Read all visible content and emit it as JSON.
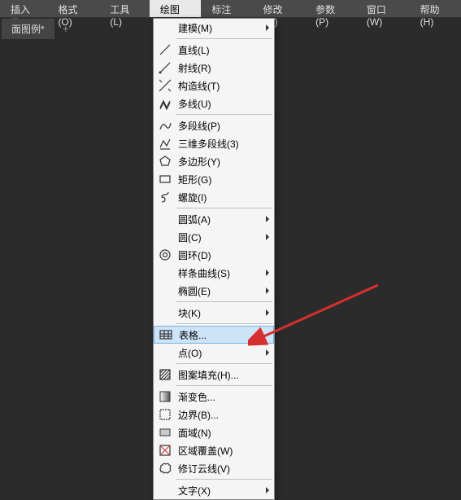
{
  "menubar": [
    {
      "label": "插入(I)"
    },
    {
      "label": "格式(O)"
    },
    {
      "label": "工具(L)"
    },
    {
      "label": "绘图(D)",
      "active": true
    },
    {
      "label": "标注(N)"
    },
    {
      "label": "修改(M)"
    },
    {
      "label": "参数(P)"
    },
    {
      "label": "窗口(W)"
    },
    {
      "label": "帮助(H)"
    }
  ],
  "tab": {
    "label": "面图例*"
  },
  "menu_groups": [
    [
      {
        "label": "建模(M)",
        "icon": "",
        "submenu": true
      }
    ],
    [
      {
        "label": "直线(L)",
        "icon": "line"
      },
      {
        "label": "射线(R)",
        "icon": "ray"
      },
      {
        "label": "构造线(T)",
        "icon": "xline"
      },
      {
        "label": "多线(U)",
        "icon": "mline"
      }
    ],
    [
      {
        "label": "多段线(P)",
        "icon": "pline"
      },
      {
        "label": "三维多段线(3)",
        "icon": "pline3d"
      },
      {
        "label": "多边形(Y)",
        "icon": "polygon"
      },
      {
        "label": "矩形(G)",
        "icon": "rect"
      },
      {
        "label": "螺旋(I)",
        "icon": "helix"
      }
    ],
    [
      {
        "label": "圆弧(A)",
        "icon": "",
        "submenu": true
      },
      {
        "label": "圆(C)",
        "icon": "",
        "submenu": true
      },
      {
        "label": "圆环(D)",
        "icon": "donut"
      },
      {
        "label": "样条曲线(S)",
        "icon": "",
        "submenu": true
      },
      {
        "label": "椭圆(E)",
        "icon": "",
        "submenu": true
      }
    ],
    [
      {
        "label": "块(K)",
        "icon": "",
        "submenu": true
      }
    ],
    [
      {
        "label": "表格...",
        "icon": "table",
        "highlight": true
      },
      {
        "label": "点(O)",
        "icon": "",
        "submenu": true
      }
    ],
    [
      {
        "label": "图案填充(H)...",
        "icon": "hatch"
      }
    ],
    [
      {
        "label": "渐变色...",
        "icon": "gradient"
      },
      {
        "label": "边界(B)...",
        "icon": "boundary"
      },
      {
        "label": "面域(N)",
        "icon": "region"
      },
      {
        "label": "区域覆盖(W)",
        "icon": "wipeout"
      },
      {
        "label": "修订云线(V)",
        "icon": "revcloud"
      }
    ],
    [
      {
        "label": "文字(X)",
        "icon": "",
        "submenu": true
      }
    ]
  ]
}
